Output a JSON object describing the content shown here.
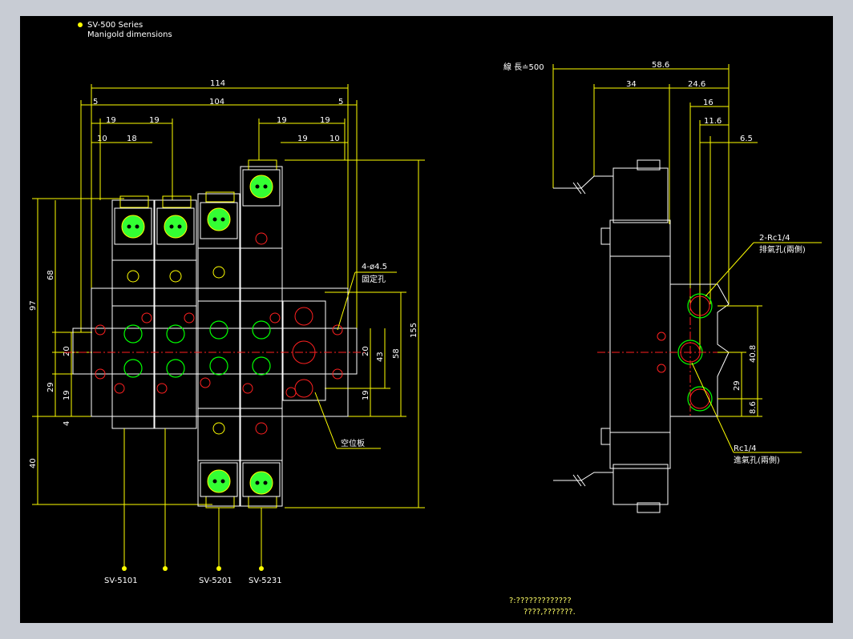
{
  "header": {
    "series_title": "SV-500 Series",
    "subtitle": "Manigold dimensions"
  },
  "dims_front": {
    "d114": "114",
    "d5a": "5",
    "d104": "104",
    "d5b": "5",
    "d19a": "19",
    "d19b": "19",
    "d19c": "19",
    "d19d": "19",
    "d10a": "10",
    "d18": "18",
    "d19e": "19",
    "d10b": "10",
    "d97": "97",
    "d68": "68",
    "d20a": "20",
    "d29": "29",
    "d19f": "19",
    "d4": "4",
    "d40": "40",
    "d20b": "20",
    "d43": "43",
    "d58": "58",
    "d155": "155",
    "d19g": "19"
  },
  "labels_front": {
    "hole_spec": "4-ø4.5",
    "hole_cn": "固定孔",
    "blank_plate": "空位板",
    "model_a": "SV-5101",
    "model_b": "SV-5201",
    "model_c": "SV-5231"
  },
  "dims_side": {
    "wire_len": "線 長≐500",
    "d58_6": "58.6",
    "d34": "34",
    "d24_6": "24.6",
    "d16": "16",
    "d11_6": "11.6",
    "d6_5": "6.5",
    "d40_8": "40.8",
    "d29": "29",
    "d8_6": "8.6"
  },
  "labels_side": {
    "exhaust": "2-Rc1/4",
    "exhaust_cn": "排氣孔(兩側)",
    "inlet": "Rc1/4",
    "inlet_cn": "進氣孔(兩側)"
  },
  "footer": {
    "line1": "?:?????????????",
    "line2": "????,???????."
  }
}
